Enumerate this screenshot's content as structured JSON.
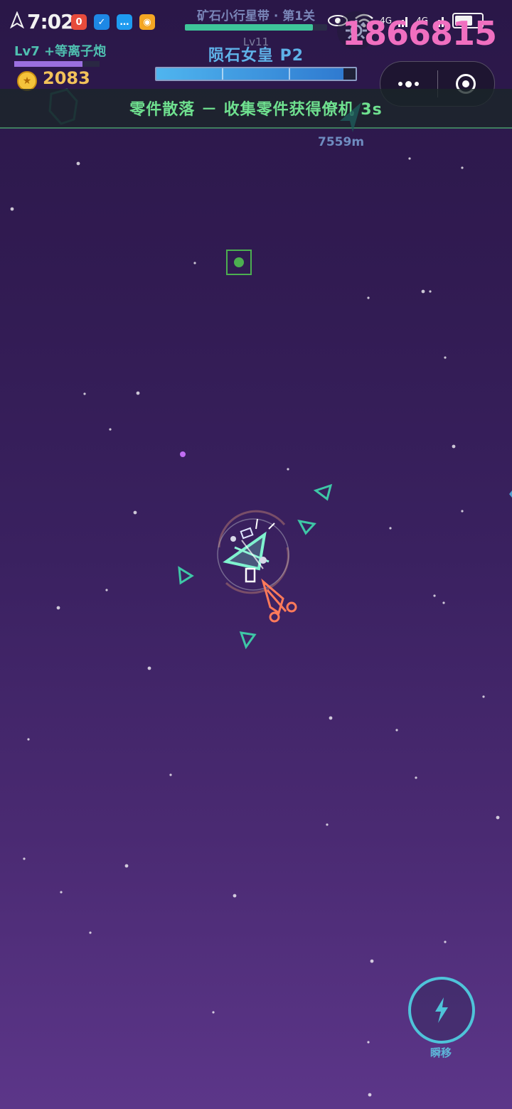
{
  "status_bar": {
    "time": "7:02",
    "app_icons": [
      {
        "name": "red-app-icon",
        "glyph": "0",
        "color": "#e74c3c"
      },
      {
        "name": "shield-app-icon",
        "glyph": "✓",
        "color": "#1e88e5"
      },
      {
        "name": "chat-app-icon",
        "glyph": "…",
        "color": "#1e9bf0"
      },
      {
        "name": "yellow-app-icon",
        "glyph": "◉",
        "color": "#f4a623"
      }
    ],
    "signal_label_1": "4G",
    "signal_label_2": "4G"
  },
  "stage": {
    "title": "矿石小行星带 · 第1关",
    "progress": 0.9
  },
  "score": "1866815",
  "boss": {
    "level": "Lv11",
    "name": "陨石女皇  P2",
    "hp_fraction": 0.94
  },
  "player": {
    "level_text": "Lv7 +等离子炮",
    "xp_fraction": 0.8,
    "coins": "2083"
  },
  "event": {
    "text": "零件散落 － 收集零件获得僚机  3s"
  },
  "distance": "7559m",
  "teleport": {
    "label": "瞬移"
  },
  "colors": {
    "accent_green": "#6fe08f",
    "score_pink": "#f06fc0",
    "enemy_teal": "#3ec7a6",
    "player_orange": "#ff7a5a"
  }
}
